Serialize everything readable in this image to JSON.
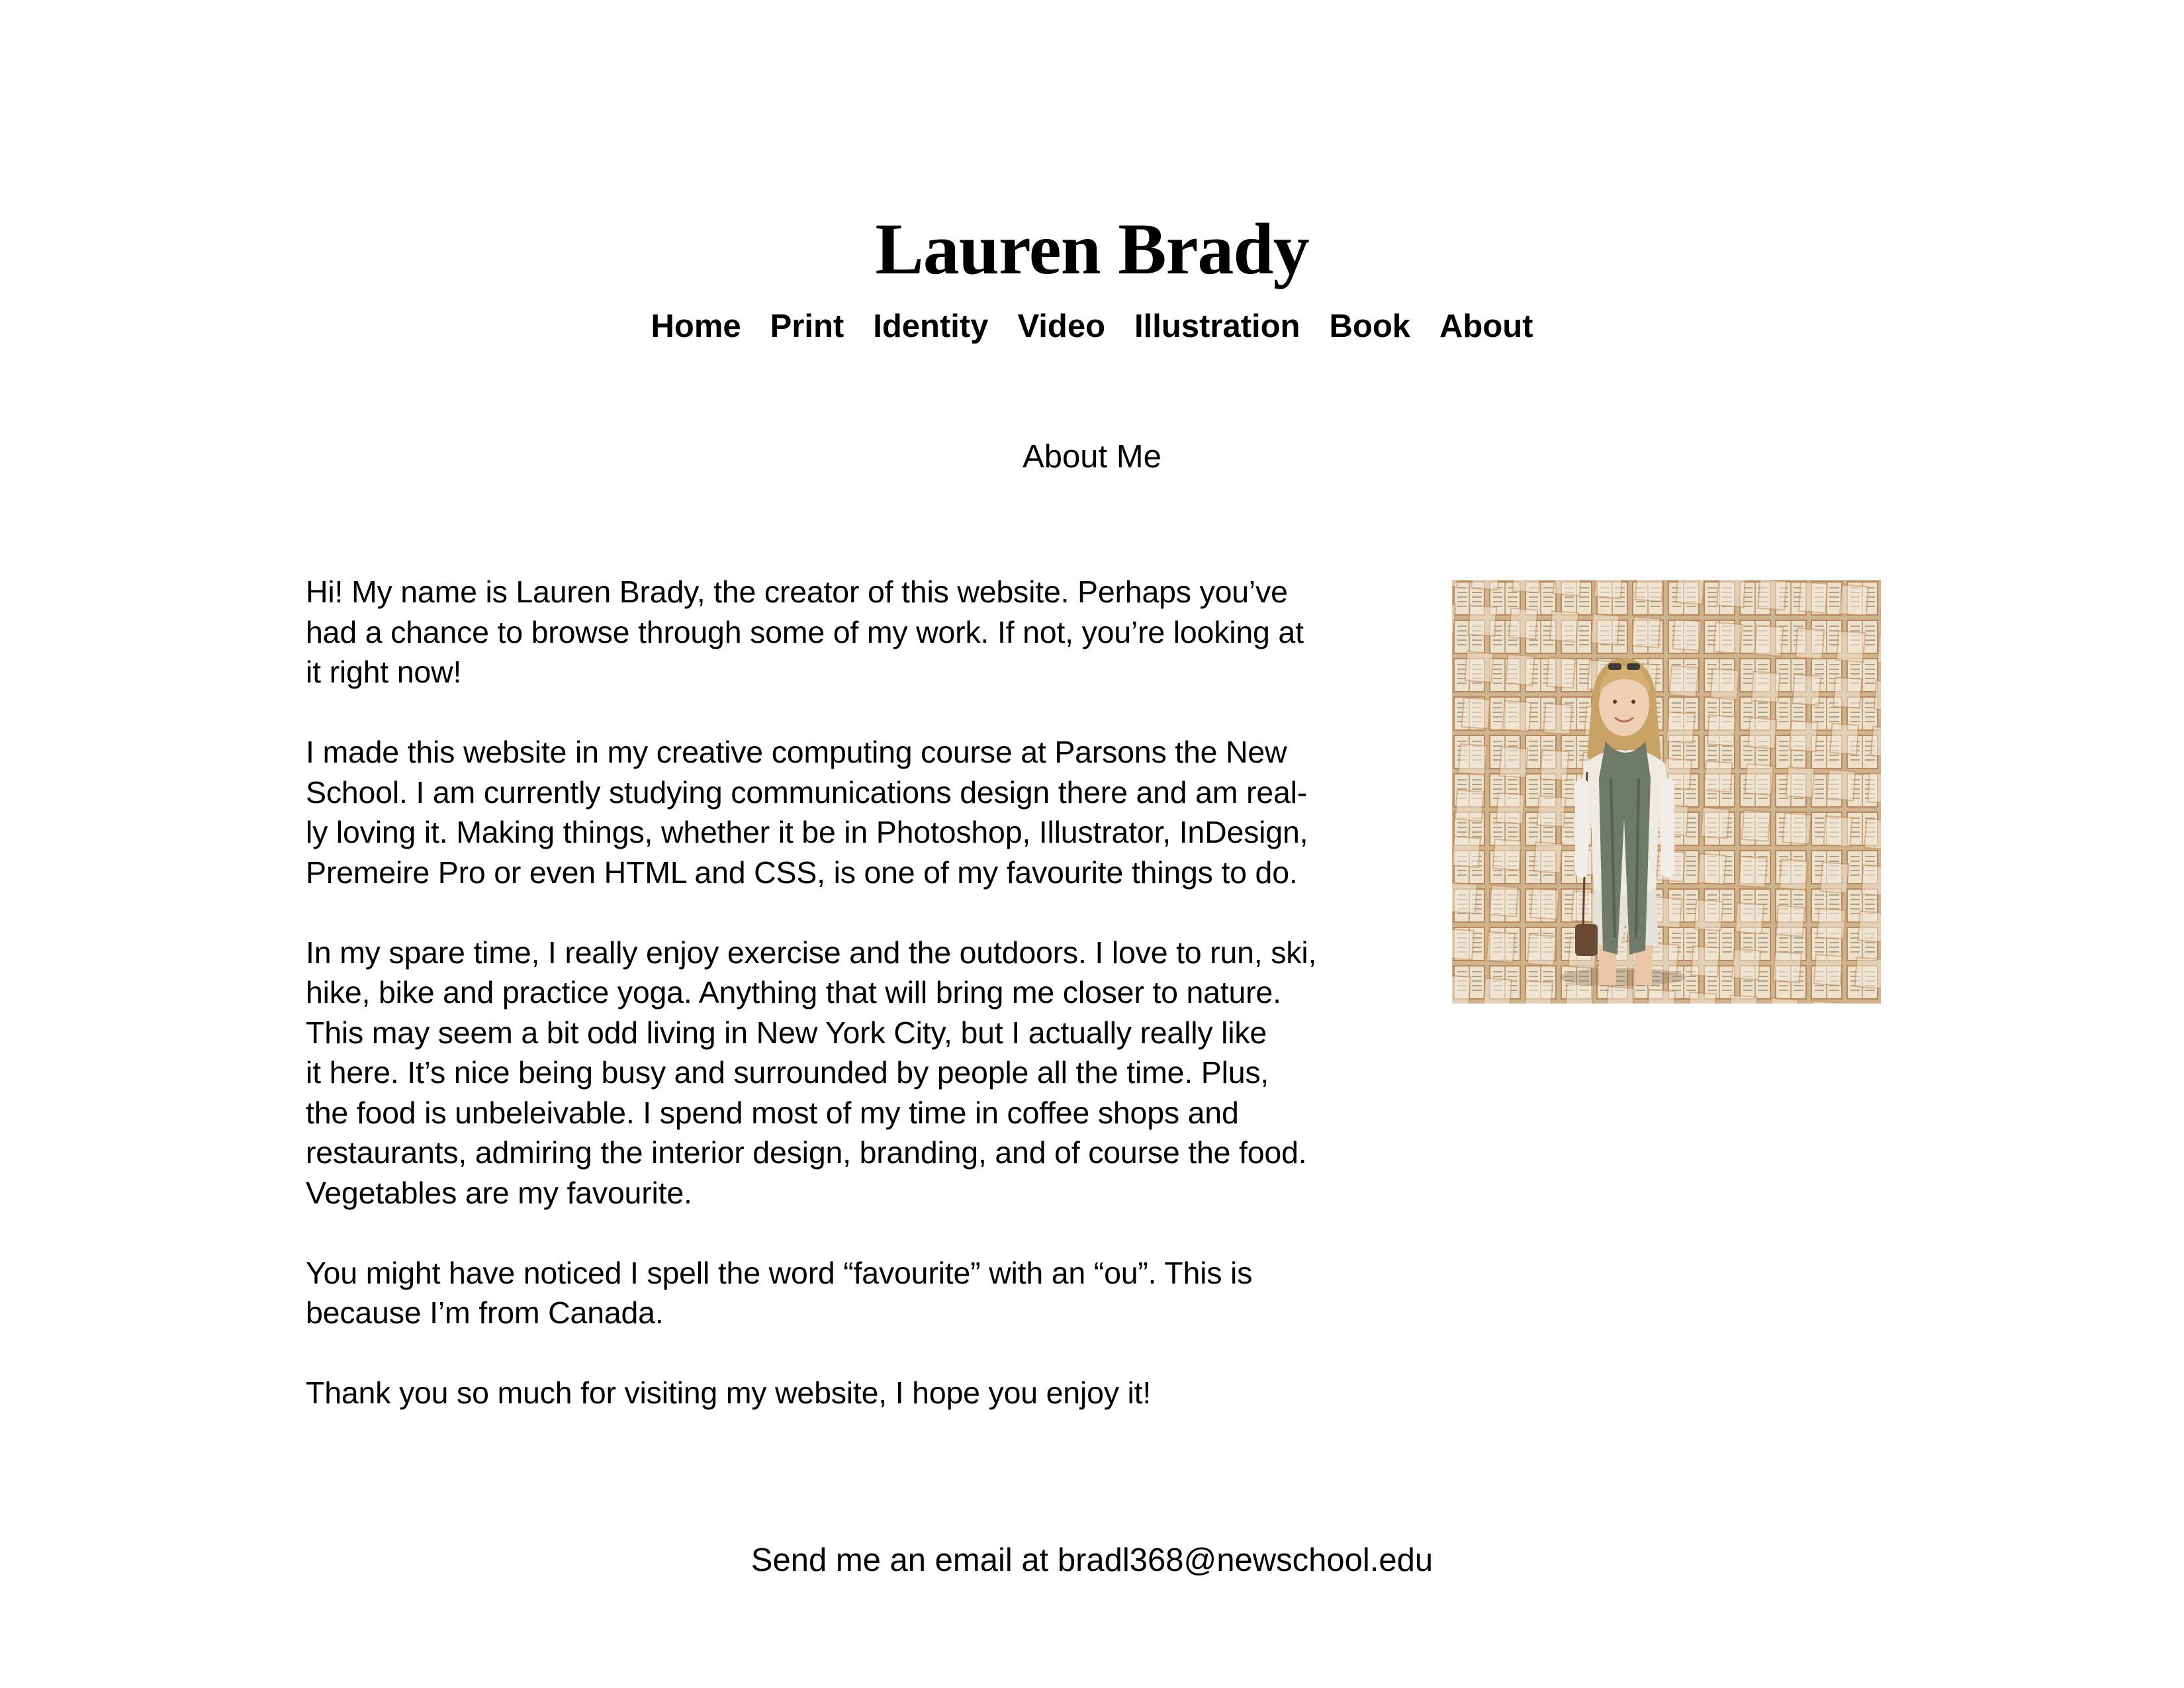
{
  "header": {
    "title": "Lauren Brady"
  },
  "nav": {
    "items": [
      {
        "label": "Home"
      },
      {
        "label": "Print"
      },
      {
        "label": "Identity"
      },
      {
        "label": "Video"
      },
      {
        "label": "Illustration"
      },
      {
        "label": "Book"
      },
      {
        "label": "About"
      }
    ]
  },
  "main": {
    "section_title": "About Me",
    "paragraphs": [
      "Hi! My name is Lauren Brady, the creator of this website. Perhaps you’ve\nhad a chance to browse through some of my work. If not, you’re looking at\nit right now!",
      "I made this website in my creative computing course at Parsons the New\nSchool. I am currently studying communications design there and am real-\nly loving it. Making things, whether it be in Photoshop, Illustrator, InDesign,\nPremeire Pro or even HTML and CSS, is one of my favourite things to do.",
      "In my spare time, I really enjoy exercise and the outdoors. I love to run, ski,\nhike, bike and practice yoga. Anything that will bring me closer to nature.\nThis may seem a bit odd living in New York City, but I actually really like\nit here. It’s nice being busy and surrounded by people all the time. Plus,\nthe food is unbeleivable. I spend most of my time in coffee shops and\nrestaurants, admiring the interior design, branding, and of course the food.\nVegetables are my favourite.",
      "You might have noticed I spell the word “favourite” with an “ou”. This is\nbecause I’m from Canada.",
      "Thank you so much for visiting my website, I hope you enjoy it!"
    ]
  },
  "footer": {
    "contact_text": "Send me an email at bradl368@newschool.edu"
  }
}
